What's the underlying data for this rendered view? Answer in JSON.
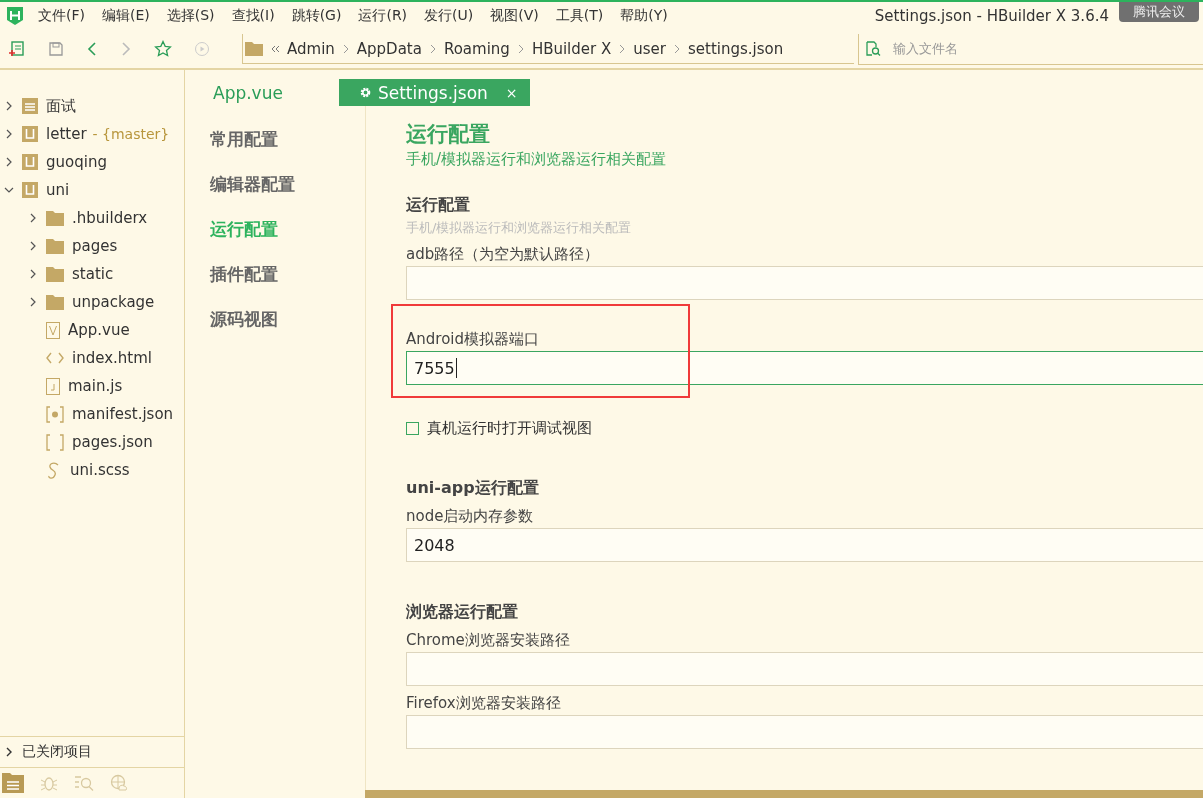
{
  "menu": [
    {
      "label": "文件(F)"
    },
    {
      "label": "编辑(E)"
    },
    {
      "label": "选择(S)"
    },
    {
      "label": "查找(I)"
    },
    {
      "label": "跳转(G)"
    },
    {
      "label": "运行(R)"
    },
    {
      "label": "发行(U)"
    },
    {
      "label": "视图(V)"
    },
    {
      "label": "工具(T)"
    },
    {
      "label": "帮助(Y)"
    }
  ],
  "window": {
    "title": "Settings.json - HBuilder X 3.6.4"
  },
  "meeting_bar": {
    "label": "腾讯会议"
  },
  "breadcrumb": [
    "Admin",
    "AppData",
    "Roaming",
    "HBuilder X",
    "user",
    "settings.json"
  ],
  "file_search": {
    "placeholder": "输入文件名"
  },
  "tree": [
    {
      "label": "面试",
      "kind": "folder-project",
      "expanded": false
    },
    {
      "label": "letter",
      "branch": "- {master}",
      "kind": "project",
      "expanded": false
    },
    {
      "label": "guoqing",
      "kind": "project",
      "expanded": false
    },
    {
      "label": "uni",
      "kind": "project",
      "expanded": true,
      "children": [
        {
          "label": ".hbuilderx",
          "kind": "folder",
          "expanded": false
        },
        {
          "label": "pages",
          "kind": "folder",
          "expanded": false
        },
        {
          "label": "static",
          "kind": "folder",
          "expanded": false
        },
        {
          "label": "unpackage",
          "kind": "folder",
          "expanded": false
        },
        {
          "label": "App.vue",
          "kind": "vue"
        },
        {
          "label": "index.html",
          "kind": "html"
        },
        {
          "label": "main.js",
          "kind": "js"
        },
        {
          "label": "manifest.json",
          "kind": "manifest"
        },
        {
          "label": "pages.json",
          "kind": "json"
        },
        {
          "label": "uni.scss",
          "kind": "scss"
        }
      ]
    }
  ],
  "closed_projects": {
    "label": "已关闭项目",
    "expanded": false
  },
  "tabs": [
    {
      "label": "App.vue",
      "selected": false
    },
    {
      "label": "Settings.json",
      "selected": true,
      "close": "×"
    }
  ],
  "settings_nav": [
    {
      "label": "常用配置",
      "selected": false
    },
    {
      "label": "编辑器配置",
      "selected": false
    },
    {
      "label": "运行配置",
      "selected": true
    },
    {
      "label": "插件配置",
      "selected": false
    },
    {
      "label": "源码视图",
      "selected": false
    }
  ],
  "page": {
    "title": "运行配置",
    "subtitle": "手机/模拟器运行和浏览器运行相关配置"
  },
  "sections": [
    {
      "title": "运行配置",
      "subtitle": "手机/模拟器运行和浏览器运行相关配置",
      "items": [
        {
          "kind": "field",
          "label": "adb路径（为空为默认路径）",
          "value": "",
          "focused": false,
          "highlighted": false
        },
        {
          "kind": "field",
          "label": "Android模拟器端口",
          "value": "7555",
          "focused": true,
          "highlighted": true
        },
        {
          "kind": "checkbox",
          "label": "真机运行时打开调试视图",
          "checked": false
        }
      ]
    },
    {
      "title": "uni-app运行配置",
      "items": [
        {
          "kind": "field",
          "label": "node启动内存参数",
          "value": "2048",
          "focused": false,
          "highlighted": false
        }
      ]
    },
    {
      "title": "浏览器运行配置",
      "items": [
        {
          "kind": "field",
          "label": "Chrome浏览器安装路径",
          "value": "",
          "focused": false,
          "highlighted": false
        },
        {
          "kind": "field",
          "label": "Firefox浏览器安装路径",
          "value": "",
          "focused": false,
          "highlighted": false
        }
      ]
    }
  ]
}
